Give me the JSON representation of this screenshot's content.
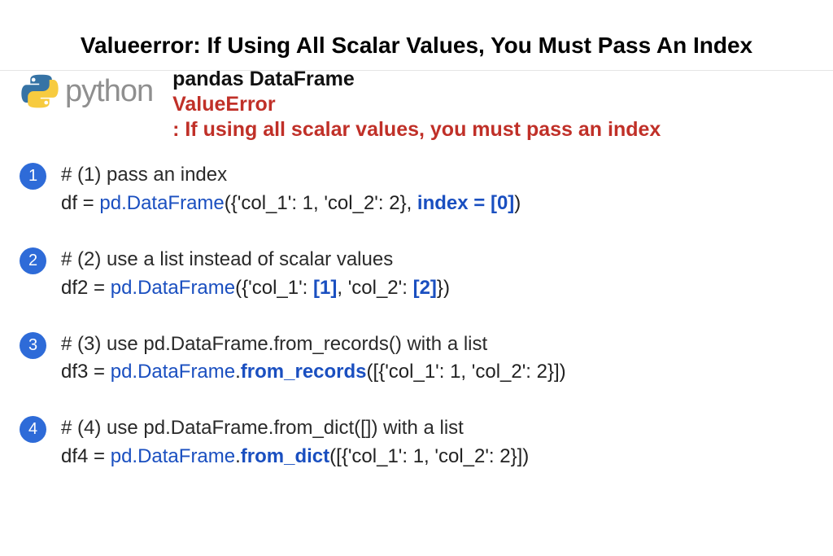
{
  "title": "Valueerror: If Using All Scalar Values, You Must Pass An Index",
  "logo_text": "python",
  "header": {
    "line1": "pandas DataFrame",
    "line2": "ValueError",
    "line3": ": If using all scalar values, you must pass an index"
  },
  "examples": [
    {
      "num": "1",
      "comment": "# (1) pass an index",
      "pre": "df = ",
      "blue1": "pd.DataFrame",
      "mid": "({'col_1': 1, 'col_2': 2}, ",
      "blue_bold": "index = [0]",
      "tail": ")"
    },
    {
      "num": "2",
      "comment": "# (2) use a list instead of scalar values",
      "pre": "df2 = ",
      "blue1": "pd.DataFrame",
      "mid": "({'col_1': ",
      "blue_bold": "[1]",
      "mid2": ", 'col_2': ",
      "blue_bold2": "[2]",
      "tail": "})"
    },
    {
      "num": "3",
      "comment": "# (3) use pd.DataFrame.from_records() with a list",
      "pre": "df3 = ",
      "blue1": "pd.DataFrame",
      "dot": ".",
      "blue_bold_method": "from_records",
      "tail": "([{'col_1': 1, 'col_2': 2}])"
    },
    {
      "num": "4",
      "comment": "# (4) use pd.DataFrame.from_dict([]) with a list",
      "pre": "df4 = ",
      "blue1": "pd.DataFrame",
      "dot": ".",
      "blue_bold_method": "from_dict",
      "tail": "([{'col_1': 1, 'col_2': 2}])"
    }
  ]
}
